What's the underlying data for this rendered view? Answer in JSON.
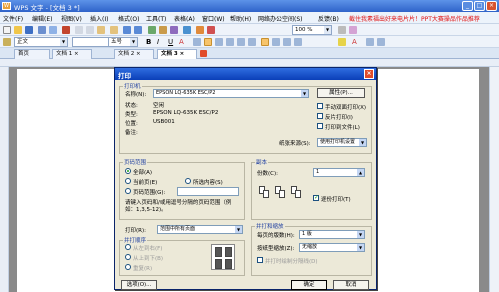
{
  "app": {
    "title": "WPS 文字 - [文档 3 *]"
  },
  "menu": {
    "items": [
      "文件(F)",
      "编辑(E)",
      "视图(V)",
      "插入(I)",
      "格式(O)",
      "工具(T)",
      "表格(A)",
      "窗口(W)",
      "帮助(H)",
      "网络办公空间(S)",
      "反馈(B)"
    ],
    "promo": "截住我素福出好来电片片！PPT大赛操品作品推荐"
  },
  "toolbar2": {
    "style": "正文",
    "font_size": "五号",
    "zoom": "100 %"
  },
  "tabs": [
    "首页",
    "文档 1 ×",
    "文档 2 ×",
    "文档 3 ×"
  ],
  "doc": {
    "text": "高"
  },
  "dialog": {
    "title": "打印",
    "printer": {
      "group": "打印机",
      "name_label": "名称(N):",
      "name_value": "EPSON LQ-635K ESC/P2",
      "props_btn": "属性(P)...",
      "status_label": "状态:",
      "status_value": "空闲",
      "type_label": "类型:",
      "type_value": "EPSON LQ-635K ESC/P2",
      "where_label": "位置:",
      "where_value": "USB001",
      "comment_label": "备注:",
      "manual_duplex": "手动双面打印(X)",
      "reverse": "反片打印(I)",
      "to_file": "打印到文件(L)",
      "paper_source_label": "纸张来源(S):",
      "paper_source_value": "使用打印机设置"
    },
    "range": {
      "group": "页码范围",
      "all": "全部(A)",
      "current": "当前页(E)",
      "selection": "所选内容(S)",
      "pages": "页码范围(G):",
      "hint": "请键入页码和/或用逗号分隔的页码范围（例如：1,3,5-12)。"
    },
    "copies": {
      "group": "副本",
      "count_label": "份数(C):",
      "count_value": "1",
      "collate": "逐份打印(T)"
    },
    "print_what": {
      "label": "打印(R):",
      "value": "范围中所有页面"
    },
    "options": {
      "group": "并打顺序",
      "lr": "从左到右(F)",
      "tb": "从上到下(B)",
      "repeat": "重复(R)"
    },
    "zoom": {
      "group": "并打和缩放",
      "pages_per_sheet_label": "每页的版数(H):",
      "pages_per_sheet_value": "1 版",
      "scale_label": "按纸型缩放(Z):",
      "scale_value": "无缩放",
      "order_label": "并打时绘制分隔线(D)"
    },
    "buttons": {
      "options": "选项(O)...",
      "ok": "确定",
      "cancel": "取消"
    }
  }
}
